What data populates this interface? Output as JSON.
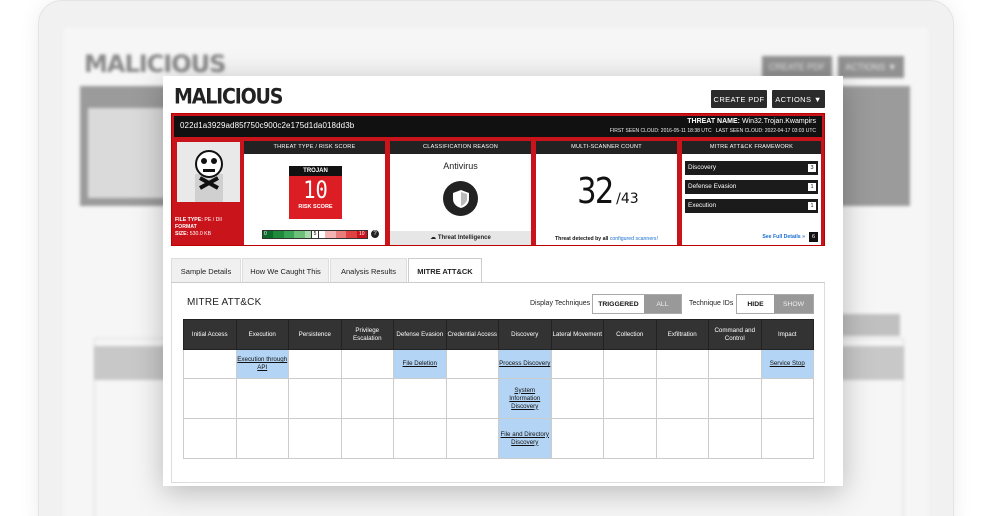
{
  "page": {
    "title": "MALICIOUS",
    "create_pdf": "CREATE PDF",
    "actions": "ACTIONS ▼"
  },
  "sample": {
    "hash": "022d1a3929ad85f750c900c2e175d1da018dd3b",
    "threat_name_label": "THREAT NAME:",
    "threat_name": "Win32.Trojan.Kwampirs",
    "first_seen": "FIRST SEEN CLOUD: 2016-05-11 18:38 UTC",
    "last_seen": "LAST SEEN CLOUD: 2022-04-17 03:03 UTC",
    "file_type_label": "FILE TYPE:",
    "file_type": "PE / Dll",
    "format_label": "FORMAT",
    "size_label": "SIZE:",
    "size": "530.0 KB"
  },
  "threat_type": {
    "header": "THREAT TYPE / RISK SCORE",
    "type": "TROJAN",
    "score": "10",
    "score_label": "RISK SCORE",
    "gauge_low": "0",
    "gauge_mid": "5",
    "gauge_high": "10",
    "help_icon": "?"
  },
  "classification": {
    "header": "CLASSIFICATION REASON",
    "reason": "Antivirus",
    "icon": "shield-icon",
    "footer": "Threat Intelligence"
  },
  "multiscanner": {
    "header": "MULTI-SCANNER COUNT",
    "detected": "32",
    "total": "/43",
    "footer_text": "Threat detected by all",
    "footer_link": "configured scanners!"
  },
  "mitre_framework": {
    "header": "MITRE ATT&CK FRAMEWORK",
    "items": [
      {
        "label": "Discovery",
        "count": "3"
      },
      {
        "label": "Defense Evasion",
        "count": "1"
      },
      {
        "label": "Execution",
        "count": "1"
      }
    ],
    "see_full": "See Full Details »",
    "badge": "6"
  },
  "tabs": [
    "Sample Details",
    "How We Caught This",
    "Analysis Results",
    "MITRE ATT&CK"
  ],
  "attack": {
    "title": "MITRE ATT&CK",
    "display_label": "Display Techniques",
    "triggered": "TRIGGERED",
    "all": "ALL",
    "ids_label": "Technique IDs",
    "hide": "HIDE",
    "show": "SHOW",
    "columns": [
      "Initial Access",
      "Execution",
      "Persistence",
      "Privilege Escalation",
      "Defense Evasion",
      "Credential Access",
      "Discovery",
      "Lateral Movement",
      "Collection",
      "Exfiltration",
      "Command and Control",
      "Impact"
    ],
    "rows": [
      [
        "",
        "Execution through API",
        "",
        "",
        "File Deletion",
        "",
        "Process Discovery",
        "",
        "",
        "",
        "",
        "Service Stop"
      ],
      [
        "",
        "",
        "",
        "",
        "",
        "",
        "System Information Discovery",
        "",
        "",
        "",
        "",
        ""
      ],
      [
        "",
        "",
        "",
        "",
        "",
        "",
        "File and Directory Discovery",
        "",
        "",
        "",
        "",
        ""
      ]
    ]
  },
  "colors": {
    "accent_red": "#c8141a",
    "highlight_blue": "#b3d4f4",
    "dark": "#222222"
  }
}
